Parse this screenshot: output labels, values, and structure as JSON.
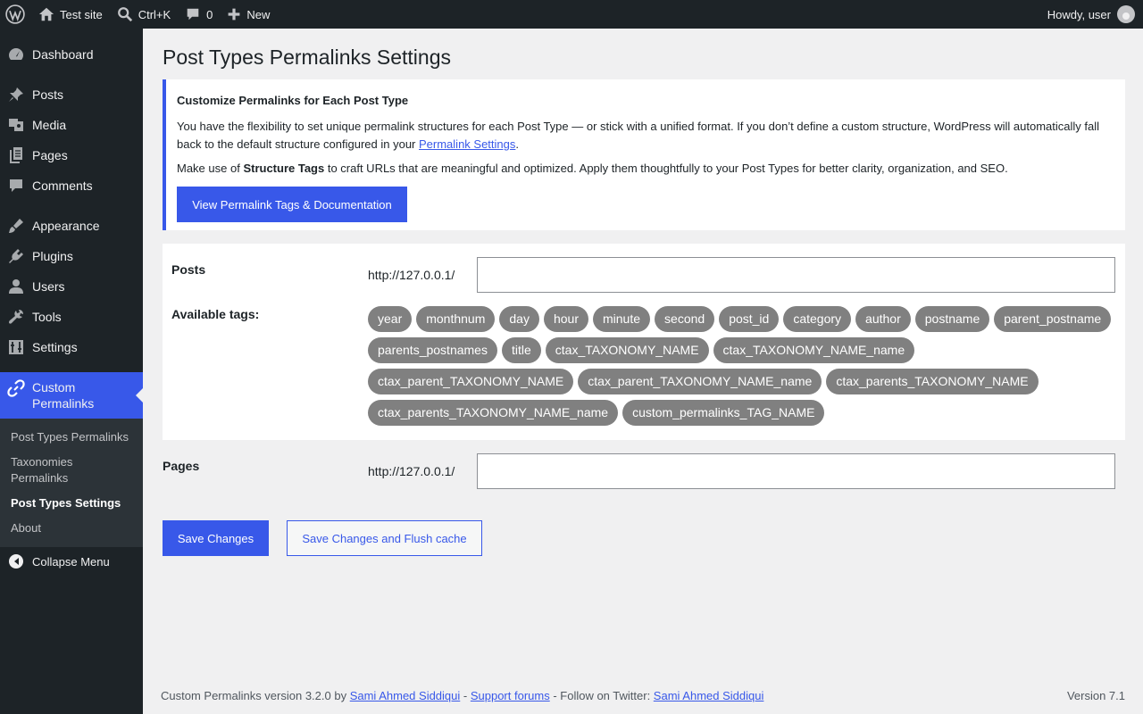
{
  "adminbar": {
    "site_name": "Test site",
    "search_shortcut": "Ctrl+K",
    "comments_count": "0",
    "new_label": "New",
    "howdy": "Howdy, user"
  },
  "sidebar": {
    "items": [
      {
        "label": "Dashboard",
        "icon": "dashboard-icon"
      },
      {
        "label": "Posts",
        "icon": "pin-icon"
      },
      {
        "label": "Media",
        "icon": "media-icon"
      },
      {
        "label": "Pages",
        "icon": "pages-icon"
      },
      {
        "label": "Comments",
        "icon": "comment-icon"
      },
      {
        "label": "Appearance",
        "icon": "brush-icon"
      },
      {
        "label": "Plugins",
        "icon": "plugin-icon"
      },
      {
        "label": "Users",
        "icon": "user-icon"
      },
      {
        "label": "Tools",
        "icon": "wrench-icon"
      },
      {
        "label": "Settings",
        "icon": "settings-icon"
      },
      {
        "label": "Custom Permalinks",
        "icon": "link-icon"
      }
    ],
    "submenu": [
      {
        "label": "Post Types Permalinks"
      },
      {
        "label": "Taxonomies Permalinks"
      },
      {
        "label": "Post Types Settings"
      },
      {
        "label": "About"
      }
    ],
    "collapse_label": "Collapse Menu"
  },
  "page": {
    "title": "Post Types Permalinks Settings"
  },
  "notice": {
    "heading": "Customize Permalinks for Each Post Type",
    "p1_text": "You have the flexibility to set unique permalink structures for each Post Type — or stick with a unified format. If you don’t define a custom structure, WordPress will automatically fall back to the default structure configured in your ",
    "p1_link": "Permalink Settings",
    "p1_end": ".",
    "p2_before": "Make use of ",
    "p2_bold": "Structure Tags",
    "p2_after": " to craft URLs that are meaningful and optimized. Apply them thoughtfully to your Post Types for better clarity, organization, and SEO.",
    "button": "View Permalink Tags & Documentation"
  },
  "posts": {
    "label": "Posts",
    "url_prefix": "http://127.0.0.1/",
    "value": "",
    "tags_label": "Available tags:",
    "tags": [
      "year",
      "monthnum",
      "day",
      "hour",
      "minute",
      "second",
      "post_id",
      "category",
      "author",
      "postname",
      "parent_postname",
      "parents_postnames",
      "title",
      "ctax_TAXONOMY_NAME",
      "ctax_TAXONOMY_NAME_name",
      "ctax_parent_TAXONOMY_NAME",
      "ctax_parent_TAXONOMY_NAME_name",
      "ctax_parents_TAXONOMY_NAME",
      "ctax_parents_TAXONOMY_NAME_name",
      "custom_permalinks_TAG_NAME"
    ]
  },
  "pages": {
    "label": "Pages",
    "url_prefix": "http://127.0.0.1/",
    "value": ""
  },
  "actions": {
    "save": "Save Changes",
    "save_flush": "Save Changes and Flush cache"
  },
  "footer": {
    "prefix": "Custom Permalinks version 3.2.0 by ",
    "author_link": "Sami Ahmed Siddiqui",
    "sep1": " - ",
    "support_link": "Support forums",
    "sep2": " - Follow on Twitter: ",
    "twitter_link": "Sami Ahmed Siddiqui",
    "version": "Version 7.1"
  },
  "colors": {
    "accent": "#3858e9",
    "adminbar": "#1d2327",
    "tag_bg": "#808080"
  }
}
